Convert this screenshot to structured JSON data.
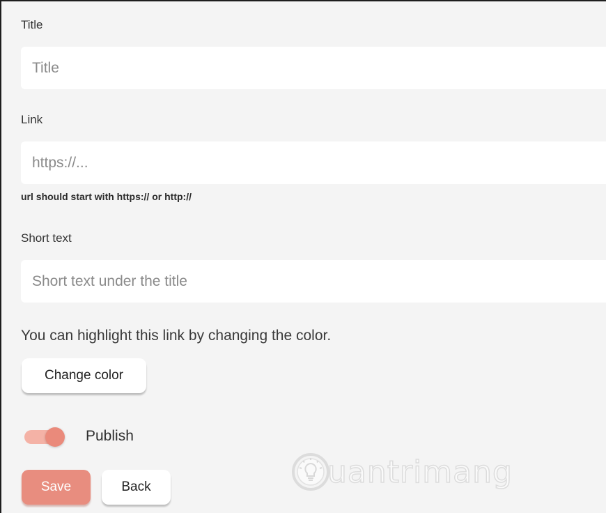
{
  "form": {
    "title": {
      "label": "Title",
      "placeholder": "Title"
    },
    "link": {
      "label": "Link",
      "placeholder": "https://...",
      "hint": "url should start with https:// or http://"
    },
    "short_text": {
      "label": "Short text",
      "placeholder": "Short text under the title"
    },
    "color": {
      "info": "You can highlight this link by changing the color.",
      "button_label": "Change color"
    },
    "publish": {
      "label": "Publish",
      "enabled": true
    },
    "actions": {
      "save_label": "Save",
      "back_label": "Back"
    }
  },
  "watermark": {
    "text": "uantrimang"
  },
  "colors": {
    "accent": "#e88d7f",
    "toggle_track": "#f4b2a6",
    "panel_background": "#f4f4f4"
  }
}
